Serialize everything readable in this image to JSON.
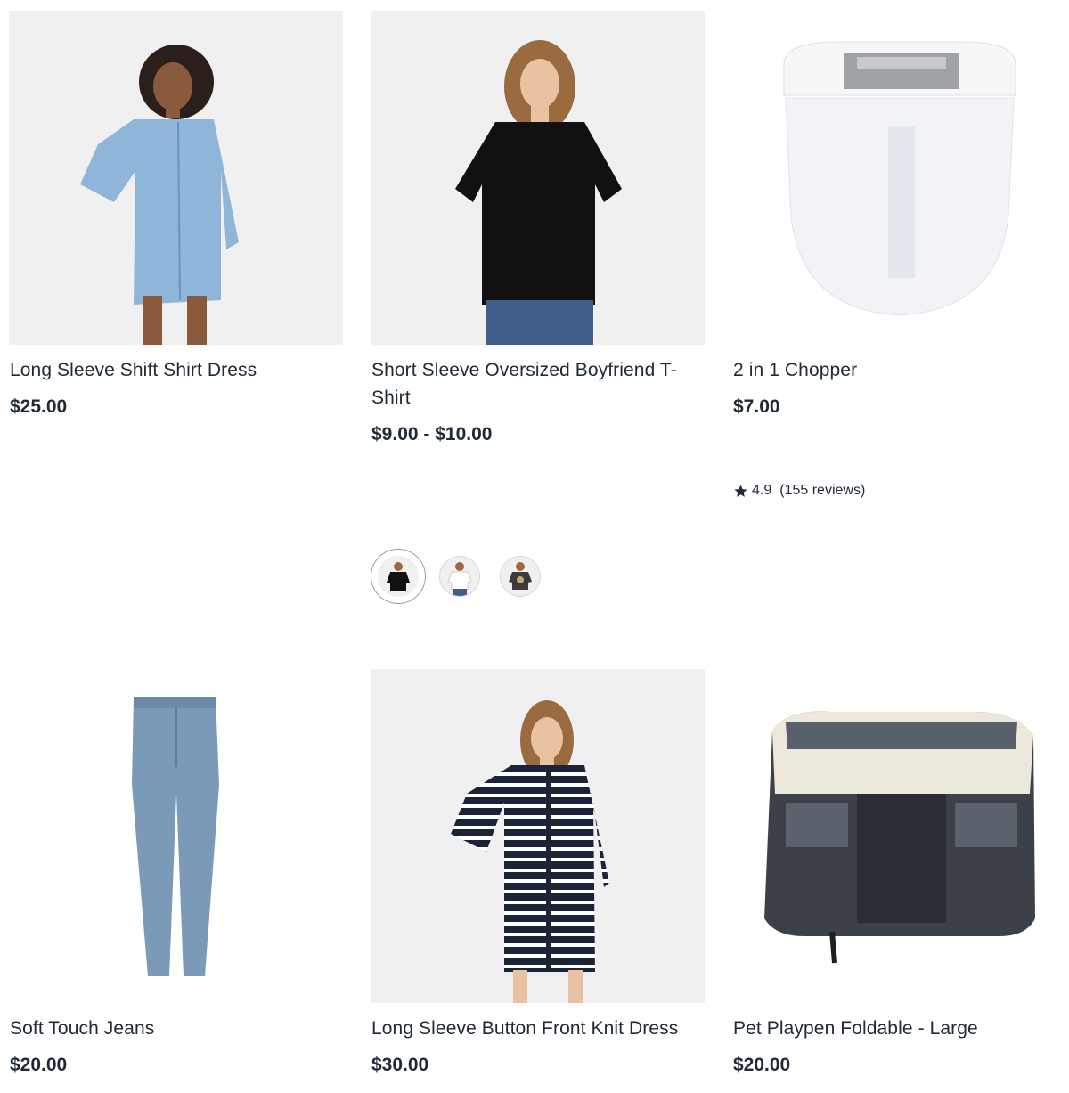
{
  "products": [
    {
      "title": "Long Sleeve Shift Shirt Dress",
      "price": "$25.00",
      "image": "woman-blue-denim-shirt-dress"
    },
    {
      "title": "Short Sleeve Oversized Boyfriend T-Shirt",
      "price": "$9.00 - $10.00",
      "image": "woman-black-oversized-tshirt"
    },
    {
      "title": "2 in 1 Chopper",
      "price": "$7.00",
      "image": "clear-plastic-chopper",
      "rating": {
        "value": "4.9",
        "reviews": "(155 reviews)"
      }
    },
    {
      "title": "Soft Touch Jeans",
      "price": "$20.00",
      "image": "light-blue-jeans"
    },
    {
      "title": "Long Sleeve Button Front Knit Dress",
      "price": "$30.00",
      "image": "woman-striped-knit-dress"
    },
    {
      "title": "Pet Playpen Foldable - Large",
      "price": "$20.00",
      "image": "grey-cream-pet-playpen"
    }
  ],
  "color_swatches": [
    {
      "name": "black",
      "selected": true
    },
    {
      "name": "white",
      "selected": false
    },
    {
      "name": "charcoal-print",
      "selected": false
    }
  ],
  "icons": {
    "rating": "star-icon"
  },
  "colors": {
    "text": "#1f2a36",
    "image_bg": "#f0f0f1"
  }
}
